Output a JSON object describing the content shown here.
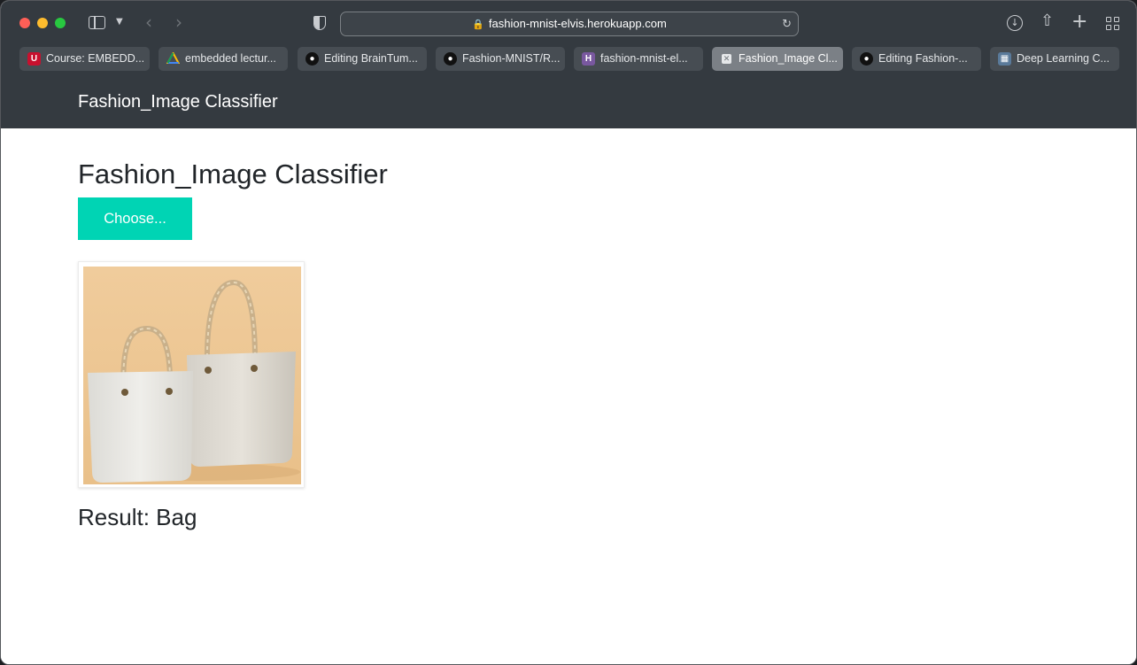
{
  "browser": {
    "url": "fashion-mnist-elvis.herokuapp.com",
    "tabs": [
      {
        "label": "Course: EMBEDD...",
        "icon": "university-icon",
        "active": false
      },
      {
        "label": "embedded lectur...",
        "icon": "google-drive-icon",
        "active": false
      },
      {
        "label": "Editing BrainTum...",
        "icon": "github-icon",
        "active": false
      },
      {
        "label": "Fashion-MNIST/R...",
        "icon": "github-icon",
        "active": false
      },
      {
        "label": "fashion-mnist-el...",
        "icon": "heroku-icon",
        "active": false
      },
      {
        "label": "Fashion_Image Cl...",
        "icon": "close-icon",
        "active": true
      },
      {
        "label": "Editing Fashion-...",
        "icon": "github-icon",
        "active": false
      },
      {
        "label": "Deep Learning C...",
        "icon": "document-icon",
        "active": false
      }
    ]
  },
  "navbar": {
    "brand": "Fashion_Image Classifier"
  },
  "main": {
    "title": "Fashion_Image Classifier",
    "choose_label": "Choose...",
    "result": "Result: Bag"
  },
  "colors": {
    "chrome": "#343a40",
    "accent": "#00d4b4",
    "text": "#212529"
  }
}
